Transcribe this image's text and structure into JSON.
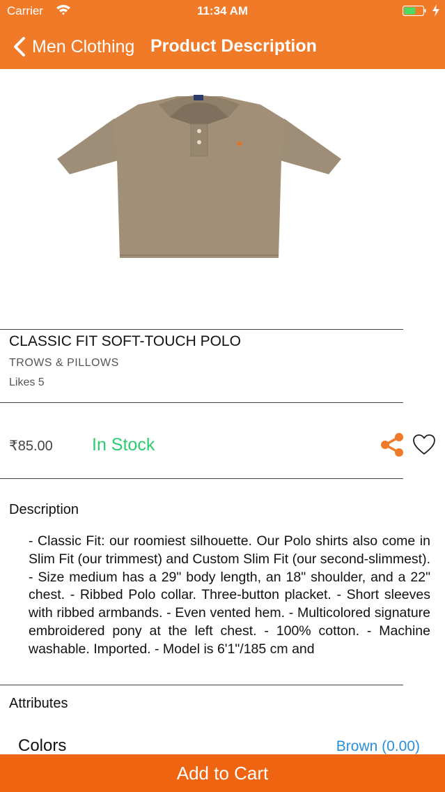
{
  "status_bar": {
    "carrier": "Carrier",
    "time": "11:34 AM"
  },
  "nav": {
    "back_label": "Men Clothing",
    "title": "Product Description"
  },
  "product": {
    "name": "CLASSIC FIT SOFT-TOUCH POLO",
    "brand": "TROWS & PILLOWS",
    "likes": "Likes 5",
    "price": "₹85.00",
    "stock": "In Stock",
    "image_icon": "polo-shirt-image"
  },
  "description": {
    "heading": "Description",
    "text": "- Classic Fit: our roomiest silhouette. Our Polo shirts also come in Slim Fit (our trimmest) and Custom Slim Fit (our second-slimmest). - Size medium has a 29\" body length, an 18\" shoulder, and a 22\" chest. - Ribbed Polo collar. Three-button placket. - Short sleeves with ribbed armbands. - Even vented hem. - Multicolored signature embroidered pony at the left chest. - 100% cotton. - Machine washable. Imported. - Model is 6'1\"/185 cm and"
  },
  "attributes": {
    "heading": "Attributes",
    "colors_label": "Colors",
    "colors_value": "Brown (0.00)"
  },
  "cart": {
    "label": "Add to Cart"
  },
  "colors": {
    "accent": "#F07A28",
    "cart": "#EE6410",
    "stock": "#2ECC71",
    "link": "#2A8DD8"
  },
  "icons": [
    "wifi-icon",
    "battery-icon",
    "charging-icon",
    "back-chevron-icon",
    "share-icon",
    "heart-icon"
  ]
}
